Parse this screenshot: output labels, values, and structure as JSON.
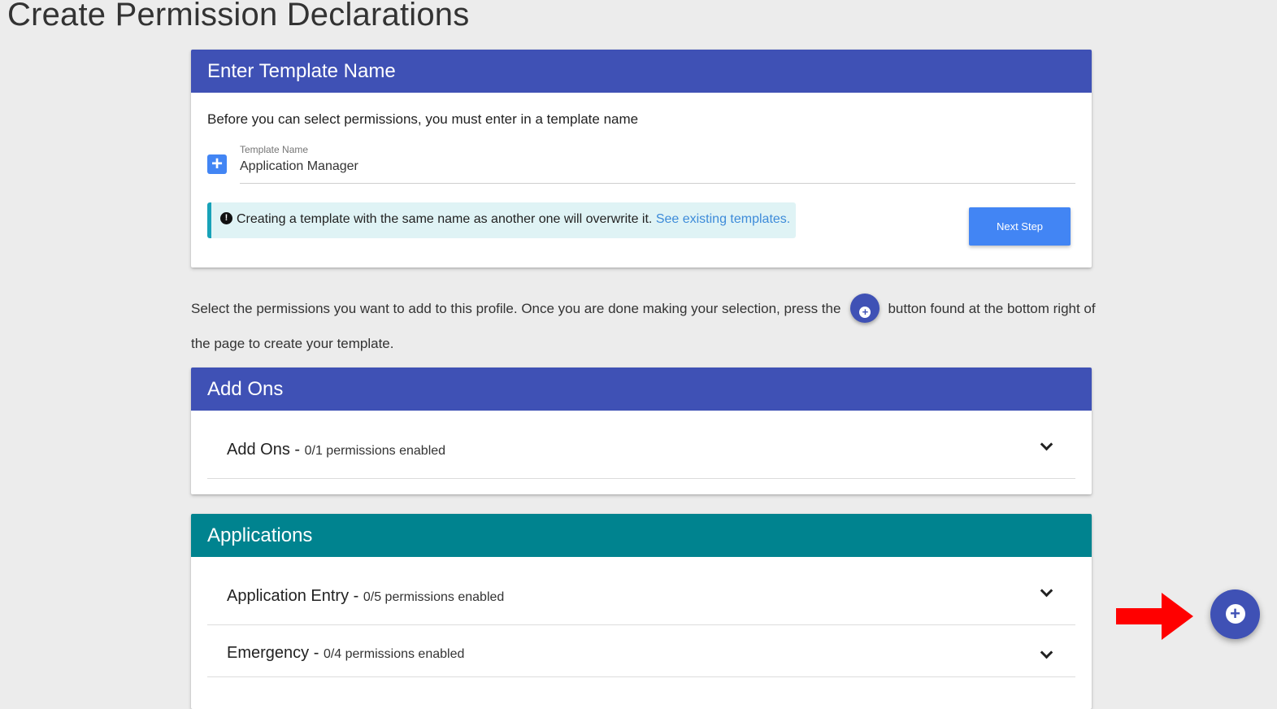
{
  "page": {
    "title": "Create Permission Declarations"
  },
  "template_card": {
    "header": "Enter Template Name",
    "intro": "Before you can select permissions, you must enter in a template name",
    "field_label": "Template Name",
    "field_value": "Application Manager",
    "alert_text": "Creating a template with the same name as another one will overwrite it.",
    "alert_link": "See existing templates.",
    "next_button": "Next Step",
    "add_icon": "plus-square-icon"
  },
  "instructions": {
    "before": "Select the permissions you want to add to this profile. Once you are done making your selection, press the",
    "after": "button found at the bottom right of the page to create your template.",
    "inline_icon": "plus-circle-icon"
  },
  "sections": [
    {
      "header": "Add Ons",
      "color": "#3f51b5",
      "items": [
        {
          "name": "Add Ons",
          "count": "0/1 permissions enabled"
        }
      ]
    },
    {
      "header": "Applications",
      "color": "#00838f",
      "items": [
        {
          "name": "Application Entry",
          "count": "0/5 permissions enabled"
        },
        {
          "name": "Emergency",
          "count": "0/4 permissions enabled"
        }
      ]
    }
  ],
  "fab": {
    "icon": "plus-circle-icon",
    "color": "#3f51b5"
  },
  "annotation": {
    "arrow_color": "#ff0000",
    "arrow_icon": "right-arrow-icon"
  }
}
